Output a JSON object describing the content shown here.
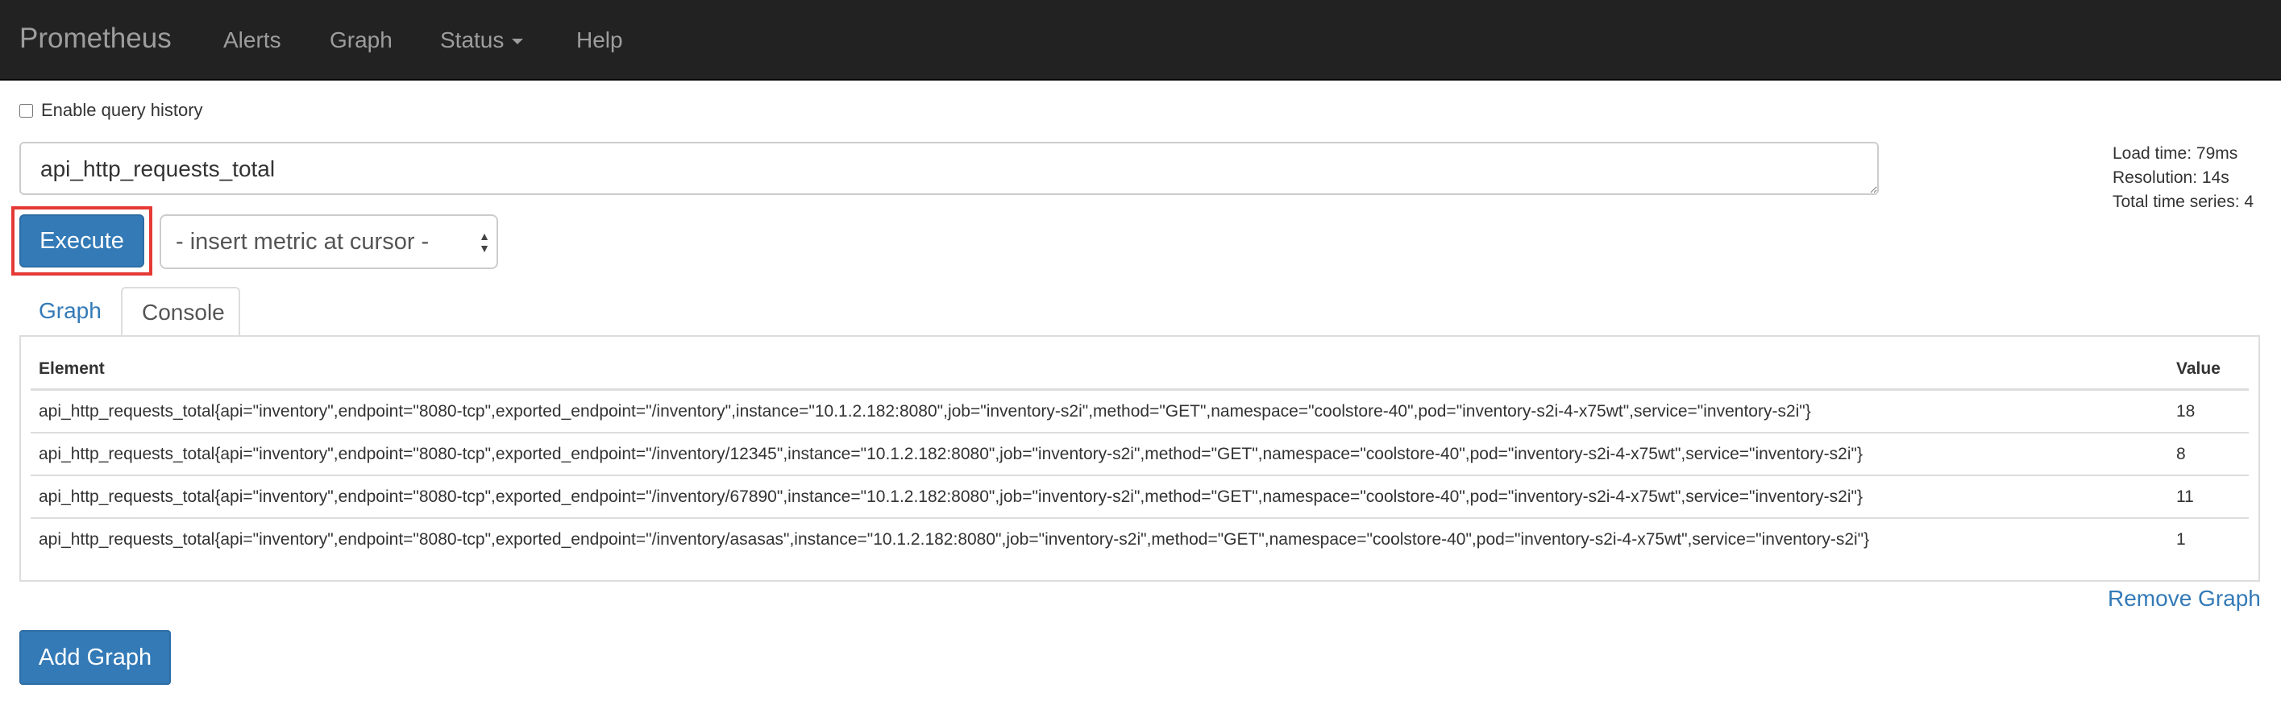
{
  "navbar": {
    "brand": "Prometheus",
    "links": {
      "alerts": "Alerts",
      "graph": "Graph",
      "status": "Status",
      "help": "Help"
    }
  },
  "query_history": {
    "label": "Enable query history",
    "checked": false
  },
  "expression": {
    "value": "api_http_requests_total"
  },
  "stats": {
    "load_time": "Load time: 79ms",
    "resolution": "Resolution: 14s",
    "total_series": "Total time series: 4"
  },
  "controls": {
    "execute_label": "Execute",
    "metric_select_label": "- insert metric at cursor -"
  },
  "tabs": {
    "graph": "Graph",
    "console": "Console",
    "active": "console"
  },
  "console_table": {
    "columns": {
      "element": "Element",
      "value": "Value"
    },
    "rows": [
      {
        "element": "api_http_requests_total{api=\"inventory\",endpoint=\"8080-tcp\",exported_endpoint=\"/inventory\",instance=\"10.1.2.182:8080\",job=\"inventory-s2i\",method=\"GET\",namespace=\"coolstore-40\",pod=\"inventory-s2i-4-x75wt\",service=\"inventory-s2i\"}",
        "value": "18"
      },
      {
        "element": "api_http_requests_total{api=\"inventory\",endpoint=\"8080-tcp\",exported_endpoint=\"/inventory/12345\",instance=\"10.1.2.182:8080\",job=\"inventory-s2i\",method=\"GET\",namespace=\"coolstore-40\",pod=\"inventory-s2i-4-x75wt\",service=\"inventory-s2i\"}",
        "value": "8"
      },
      {
        "element": "api_http_requests_total{api=\"inventory\",endpoint=\"8080-tcp\",exported_endpoint=\"/inventory/67890\",instance=\"10.1.2.182:8080\",job=\"inventory-s2i\",method=\"GET\",namespace=\"coolstore-40\",pod=\"inventory-s2i-4-x75wt\",service=\"inventory-s2i\"}",
        "value": "11"
      },
      {
        "element": "api_http_requests_total{api=\"inventory\",endpoint=\"8080-tcp\",exported_endpoint=\"/inventory/asasas\",instance=\"10.1.2.182:8080\",job=\"inventory-s2i\",method=\"GET\",namespace=\"coolstore-40\",pod=\"inventory-s2i-4-x75wt\",service=\"inventory-s2i\"}",
        "value": "1"
      }
    ]
  },
  "actions": {
    "remove_graph": "Remove Graph",
    "add_graph": "Add Graph"
  },
  "colors": {
    "navbar_bg": "#222222",
    "nav_text": "#9d9d9d",
    "primary": "#337ab7",
    "highlight": "#e53935"
  },
  "icons": {
    "select_arrows": "up-down-arrows-icon",
    "status_caret": "caret-down-icon"
  }
}
